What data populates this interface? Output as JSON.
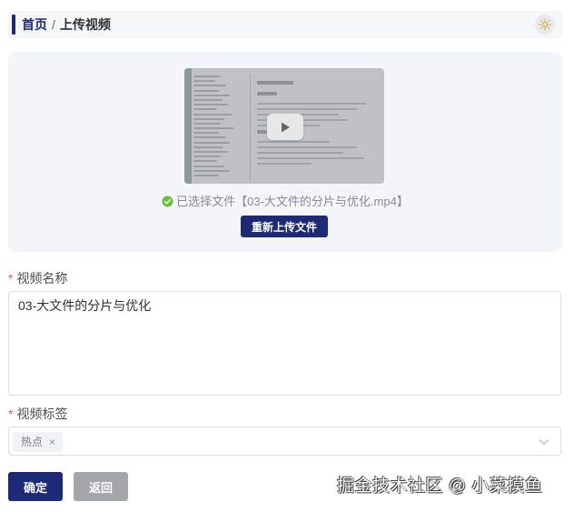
{
  "breadcrumb": {
    "home": "首页",
    "separator": "/",
    "current": "上传视频"
  },
  "theme_toggle": {
    "icon": "sun-icon"
  },
  "upload": {
    "status_icon": "check-circle-icon",
    "status_text": "已选择文件【03-大文件的分片与优化.mp4】",
    "reupload_label": "重新上传文件",
    "preview_icon": "play-icon"
  },
  "form": {
    "name_label": "视频名称",
    "name_required_mark": "*",
    "name_value": "03-大文件的分片与优化",
    "tags_label": "视频标签",
    "tags_required_mark": "*",
    "tags": [
      {
        "label": "热点",
        "close_symbol": "×"
      }
    ],
    "tags_dropdown_icon": "chevron-down-icon"
  },
  "actions": {
    "confirm_label": "确定",
    "back_label": "返回"
  },
  "watermark": "掘金技术社区 @ 小菜摸鱼",
  "colors": {
    "primary": "#1c2a78",
    "success": "#67c23a",
    "required": "#e85a5a",
    "secondary_button": "#a4a6aa",
    "panel_background": "#f3f5fa"
  }
}
